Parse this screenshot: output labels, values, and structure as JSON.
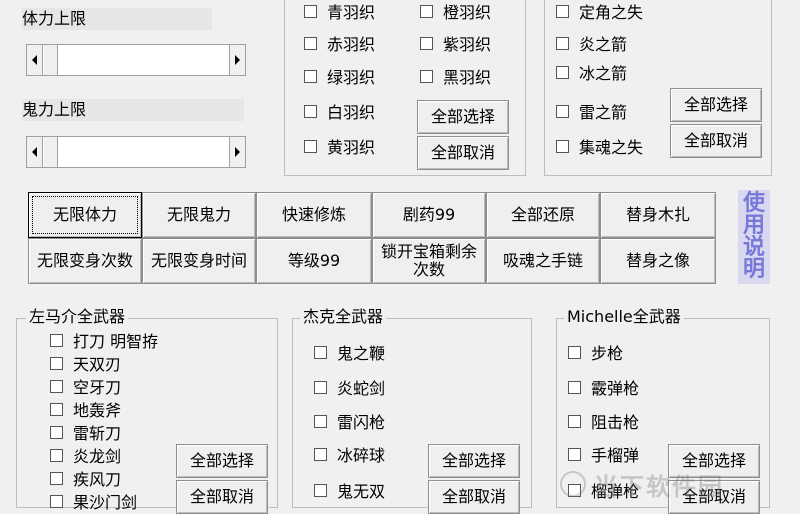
{
  "stamina": {
    "label": "体力上限",
    "value": 0
  },
  "ghost": {
    "label": "鬼力上限",
    "value": 0
  },
  "feather_group": {
    "items_left": [
      "青羽织",
      "赤羽织",
      "绿羽织",
      "白羽织",
      "黄羽织"
    ],
    "items_right": [
      "橙羽织",
      "紫羽织",
      "黑羽织"
    ],
    "select_all": "全部选择",
    "cancel_all": "全部取消"
  },
  "arrow_group": {
    "items": [
      "定角之失",
      "炎之箭",
      "冰之箭",
      "雷之箭",
      "集魂之失"
    ],
    "select_all": "全部选择",
    "cancel_all": "全部取消"
  },
  "cheats": {
    "row1": [
      "无限体力",
      "无限鬼力",
      "快速修炼",
      "剧药99",
      "全部还原",
      "替身木扎"
    ],
    "row2": [
      "无限变身次数",
      "无限变身时间",
      "等级99",
      "锁开宝箱剩余次数",
      "吸魂之手链",
      "替身之像"
    ],
    "help": [
      "使",
      "用",
      "说",
      "明"
    ]
  },
  "samanosuke": {
    "title": "左马介全武器",
    "items": [
      "打刀 明智拵",
      "天双刃",
      "空牙刀",
      "地轰斧",
      "雷斩刀",
      "炎龙剑",
      "疾风刀",
      "果沙门剑"
    ],
    "select_all": "全部选择",
    "cancel_all": "全部取消"
  },
  "jacques": {
    "title": "杰克全武器",
    "items": [
      "鬼之鞭",
      "炎蛇剑",
      "雷闪枪",
      "冰碎球",
      "鬼无双"
    ],
    "select_all": "全部选择",
    "cancel_all": "全部取消"
  },
  "michelle": {
    "title": "Michelle全武器",
    "items": [
      "步枪",
      "霰弹枪",
      "阻击枪",
      "手榴弹",
      "榴弹枪"
    ],
    "select_all": "全部选择",
    "cancel_all": "全部取消"
  },
  "watermark": "当下软件园"
}
